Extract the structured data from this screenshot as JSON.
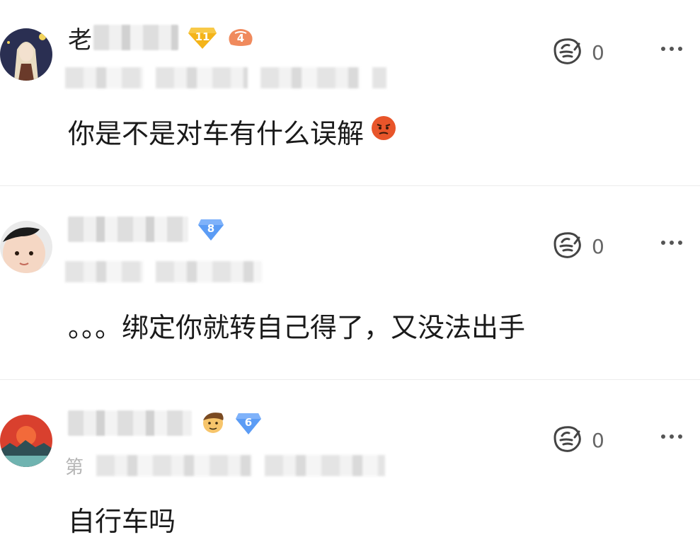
{
  "comments": [
    {
      "username_visible": "老",
      "username_tail": "?",
      "level_badge": "11",
      "fan_badge": "4",
      "content": "你是不是对车有什么误解",
      "emoji": "angry-face-emoji",
      "like_count": "0",
      "meta_hint": ""
    },
    {
      "username_visible": "",
      "username_tail": "",
      "level_badge": "8",
      "fan_badge": "",
      "content": "。。。绑定你就转自己得了，又没法出手",
      "emoji": "",
      "like_count": "0",
      "meta_hint": ""
    },
    {
      "username_visible": "",
      "username_tail": "",
      "level_badge": "6",
      "fan_badge": "",
      "content": "自行车吗",
      "emoji": "",
      "like_count": "0",
      "meta_hint": "第"
    }
  ],
  "colors": {
    "gold_badge": "#f4b41a",
    "blue_badge": "#5b9cf5",
    "fan_badge": "#f08a5d",
    "text": "#1a1a1a",
    "muted": "#666666"
  },
  "icons": {
    "like": "thumb-like-icon",
    "more": "more-dots-icon"
  }
}
